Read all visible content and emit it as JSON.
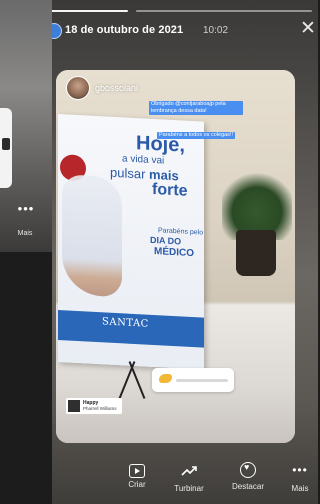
{
  "previous_story": {
    "more_label": "Mais",
    "more_icon": "more-horizontal-icon"
  },
  "header": {
    "date": "18 de outubro de 2021",
    "time": "10:02",
    "close_icon": "close-icon"
  },
  "repost": {
    "username": "gbossolani",
    "captions": [
      "Obrigado @contjaraboajp pela lembrança dessa data!",
      "Parabéns a todos os colegas!!"
    ],
    "poll_emoji": "smile-emoji",
    "music": {
      "title": "Happy",
      "artist": "Pharrell Williams"
    },
    "banner": {
      "line1": "Hoje,",
      "line2": "a vida vai",
      "line3_a": "pulsar",
      "line3_b": "mais",
      "line4": "forte",
      "line5": "Parabéns pelo",
      "line6": "DIA DO",
      "line7": "MÉDICO",
      "brand": "SANTAC"
    }
  },
  "actions": [
    {
      "label": "Criar",
      "icon": "create-video-icon"
    },
    {
      "label": "Turbinar",
      "icon": "boost-trend-icon"
    },
    {
      "label": "Destacar",
      "icon": "highlight-heart-icon"
    },
    {
      "label": "Mais",
      "icon": "more-horizontal-icon"
    }
  ],
  "colors": {
    "accent": "#4a8ff0",
    "brand_blue": "#2a5aa8"
  }
}
